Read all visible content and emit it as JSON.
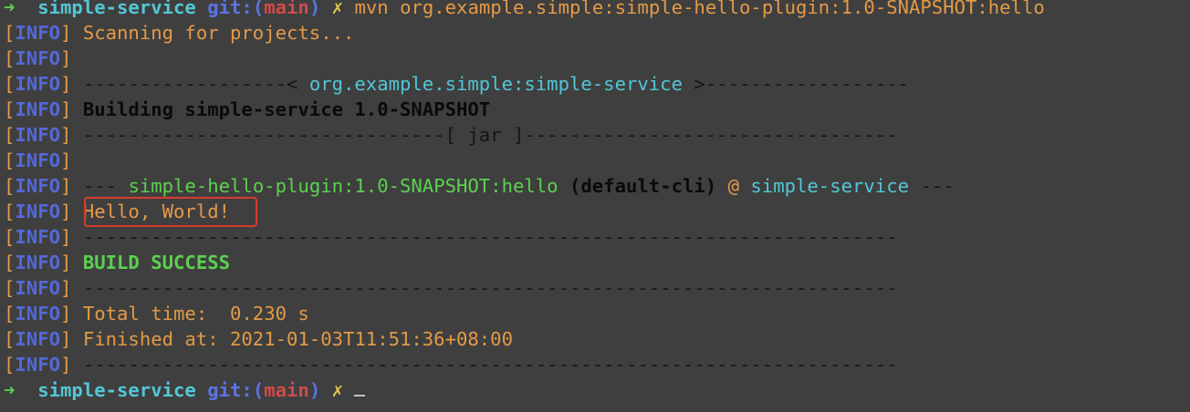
{
  "prompt": {
    "arrow": "➜",
    "dir": "simple-service",
    "git_label": "git:",
    "branch_open": "(",
    "branch": "main",
    "branch_close": ")",
    "dirty_mark": "✗",
    "command": "mvn org.example.simple:simple-hello-plugin:1.0-SNAPSHOT:hello "
  },
  "info": {
    "open": "[",
    "word": "INFO",
    "close": "]"
  },
  "lines": {
    "scanning": "Scanning for projects...",
    "sep_left": "------------------< ",
    "project_id": "org.example.simple:simple-service",
    "sep_right": " >------------------",
    "building": "Building simple-service 1.0-SNAPSHOT",
    "jar_line": "--------------------------------[ jar ]---------------------------------",
    "plugin_prefix": "--- ",
    "plugin_goal": "simple-hello-plugin:1.0-SNAPSHOT:hello",
    "plugin_exec": "(default-cli)",
    "plugin_at": "@",
    "plugin_project": "simple-service",
    "plugin_suffix": " ---",
    "hello": "Hello, World!",
    "dashes": "------------------------------------------------------------------------",
    "build_success": "BUILD SUCCESS",
    "total_time": "Total time:  0.230 s",
    "finished_at": "Finished at: 2021-01-03T11:51:36+08:00"
  },
  "prompt2": {
    "arrow": "➜",
    "dir": "simple-service",
    "git_label": "git:",
    "branch_open": "(",
    "branch": "main",
    "branch_close": ")",
    "dirty_mark": "✗"
  },
  "colors": {
    "background": "#3f3f3f",
    "info_word": "#5468d8",
    "info_bracket": "#e39a47",
    "cyan": "#52c7d6",
    "green": "#5bd14f",
    "orange": "#e39a47",
    "highlight_border": "#d83b2c"
  }
}
